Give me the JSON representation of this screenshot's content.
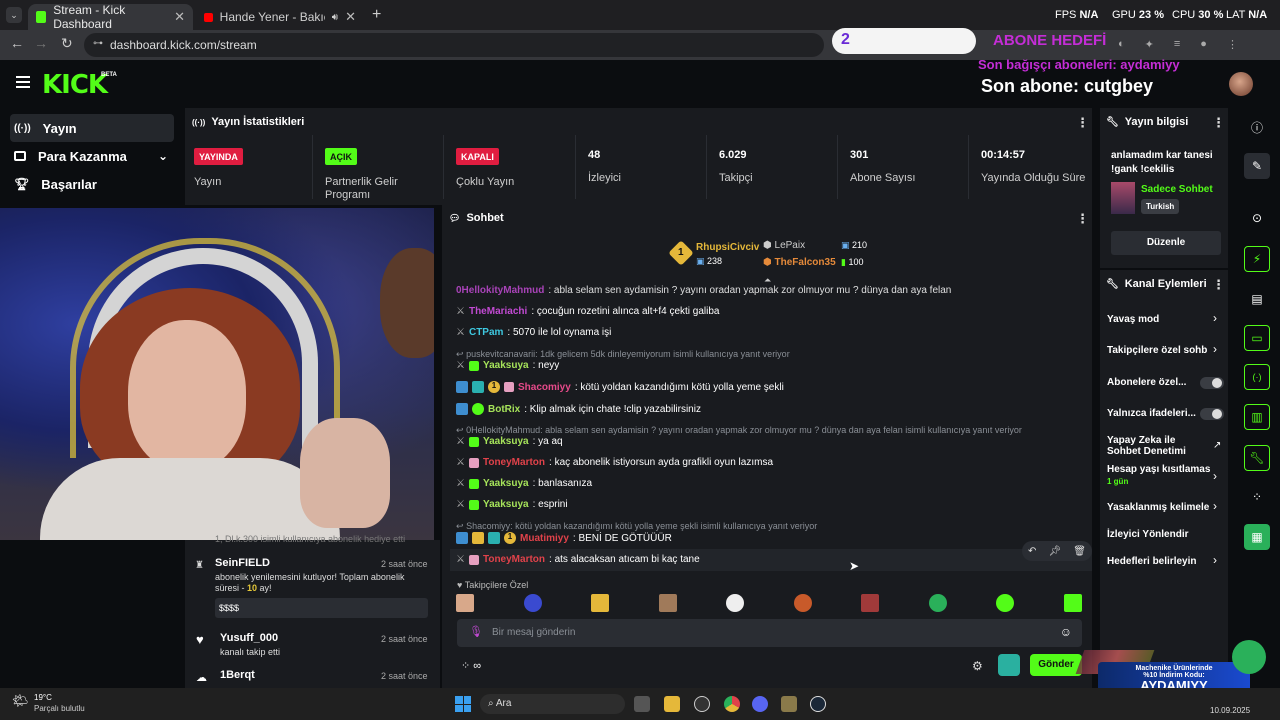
{
  "browser": {
    "tabs": [
      {
        "title": "Stream - Kick Dashboard",
        "active": true
      },
      {
        "title": "Hande Yener - Bakıcaz Artık (",
        "active": false
      }
    ],
    "url": "dashboard.kick.com/stream"
  },
  "perf": {
    "fps_label": "FPS",
    "fps_value": "N/A",
    "gpu_label": "GPU",
    "gpu_value": "23 %",
    "cpu_label": "CPU",
    "cpu_value": "30 %",
    "lat_label": "LAT",
    "lat_value": "N/A"
  },
  "overlay": {
    "goal_count": "2",
    "goal_title": "ABONE HEDEFİ",
    "last_donor": "Son bağışçı aboneleri: aydamiyy",
    "last_sub": "Son abone: cutgbey"
  },
  "logo": {
    "text": "KICK",
    "beta": "BETA"
  },
  "sidebar": {
    "items": [
      {
        "label": "Yayın",
        "icon": "broadcast-icon"
      },
      {
        "label": "Para Kazanma",
        "icon": "money-icon"
      },
      {
        "label": "Başarılar",
        "icon": "trophy-icon"
      }
    ]
  },
  "stats": {
    "title": "Yayın İstatistikleri",
    "cols": [
      {
        "badge": "YAYINDA",
        "label": "Yayın"
      },
      {
        "badge": "AÇIK",
        "label": "Partnerlik Gelir Programı"
      },
      {
        "badge": "KAPALI",
        "label": "Çoklu Yayın"
      },
      {
        "value": "48",
        "label": "İzleyici"
      },
      {
        "value": "6.029",
        "label": "Takipçi"
      },
      {
        "value": "301",
        "label": "Abone Sayısı"
      },
      {
        "value": "00:14:57",
        "label": "Yayında Olduğu Süre"
      }
    ]
  },
  "activity": {
    "partial": "1, Dl.k.300 isimli kullanıcıya abonelik hediye etti",
    "items": [
      {
        "name": "SeinFIELD",
        "time": "2 saat önce",
        "text": "abonelik yenilemesini kutluyor! Toplam abonelik süresi -",
        "months": "10",
        "months_suffix": " ay!",
        "note": "$$$$"
      },
      {
        "name": "Yusuff_000",
        "time": "2 saat önce",
        "text": "kanalı takip etti"
      },
      {
        "name": "1Berqt",
        "time": "2 saat önce"
      }
    ]
  },
  "chat": {
    "title": "Sohbet",
    "leaders": [
      {
        "name": "RhupsiCivciv",
        "value": "238"
      },
      {
        "name": "LePaix",
        "value": "210"
      },
      {
        "name": "TheFalcon35",
        "value": "100"
      }
    ],
    "messages": [
      {
        "user": "0HellokityMahmud",
        "text": ": abla selam sen aydamisin ? yayını oradan yapmak zor olmuyor mu ? dünya dan aya felan",
        "color": "#c24ad3"
      },
      {
        "user": "TheMariachi",
        "text": ": çocuğun rozetini alınca alt+f4 çekti galiba",
        "color": "#c24ad3"
      },
      {
        "user": "CTPam",
        "text": ": 5070 ile lol oynama işi",
        "color": "#3ec8e0"
      },
      {
        "reply": "puskevitcanavarii: 1dk gelicem 5dk dinleyemiyorum isimli kullanıcıya yanıt veriyor"
      },
      {
        "user": "Yaaksuya",
        "text": ": neyy",
        "color": "#a6e35a"
      },
      {
        "user": "Shacomiyy",
        "text": ": kötü yoldan kazandığımı kötü yolla yeme şekli",
        "color": "#e64a8a"
      },
      {
        "user": "BotRix",
        "text": ": Klip almak için chate !clip yazabilirsiniz",
        "color": "#a6e35a"
      },
      {
        "reply": "0HellokityMahmud: abla selam sen aydamisin ? yayını oradan yapmak zor olmuyor mu ? dünya dan aya felan isimli kullanıcıya yanıt veriyor"
      },
      {
        "user": "Yaaksuya",
        "text": ": ya aq",
        "color": "#a6e35a"
      },
      {
        "user": "ToneyMarton",
        "text": ": kaç abonelik istiyorsun ayda grafikli oyun lazımsa",
        "color": "#e0424a"
      },
      {
        "user": "Yaaksuya",
        "text": ": banlasanıza",
        "color": "#a6e35a"
      },
      {
        "user": "Yaaksuya",
        "text": ": esprini",
        "color": "#a6e35a"
      },
      {
        "reply": "Shacomiyy: kötü yoldan kazandığımı kötü yolla yeme şekli isimli kullanıcıya yanıt veriyor"
      },
      {
        "user": "Muatimiyy",
        "text": ": BENİ DE GÖTÜÜÜR",
        "color": "#e0424a"
      },
      {
        "user": "ToneyMarton",
        "text": ": ats alacaksan atıcam bi kaç tane",
        "color": "#e0424a"
      }
    ],
    "followers_label": "Takipçilere Özel",
    "input_placeholder": "Bir mesaj gönderin",
    "send_label": "Gönder"
  },
  "info": {
    "title": "Yayın bilgisi",
    "stream_title": "anlamadım kar tanesi !gank !cekilis",
    "category": "Sadece Sohbet",
    "language": "Turkish",
    "edit_label": "Düzenle"
  },
  "actions": {
    "title": "Kanal Eylemleri",
    "items": [
      {
        "label": "Yavaş mod",
        "type": "chevron"
      },
      {
        "label": "Takipçilere özel sohb",
        "type": "chevron"
      },
      {
        "label": "Abonelere özel...",
        "type": "toggle"
      },
      {
        "label": "Yalnızca ifadeleri...",
        "type": "toggle"
      },
      {
        "label": "Yapay Zeka ile Sohbet Denetimi",
        "type": "external"
      },
      {
        "label": "Hesap yaşı kısıtlamas",
        "sub": "1 gün",
        "type": "chevron"
      },
      {
        "label": "Yasaklanmış kelimele",
        "type": "chevron"
      },
      {
        "label": "İzleyici Yönlendir",
        "type": "none"
      },
      {
        "label": "Hedefleri belirleyin",
        "type": "chevron"
      }
    ]
  },
  "promo": {
    "line1": "Machenike Ürünlerinde",
    "line2": "%10 İndirim Kodu:",
    "code": "AYDAMIYY"
  },
  "taskbar": {
    "weather_temp": "19°C",
    "weather_text": "Parçalı bulutlu",
    "search": "Ara",
    "date": "10.09.2025"
  }
}
